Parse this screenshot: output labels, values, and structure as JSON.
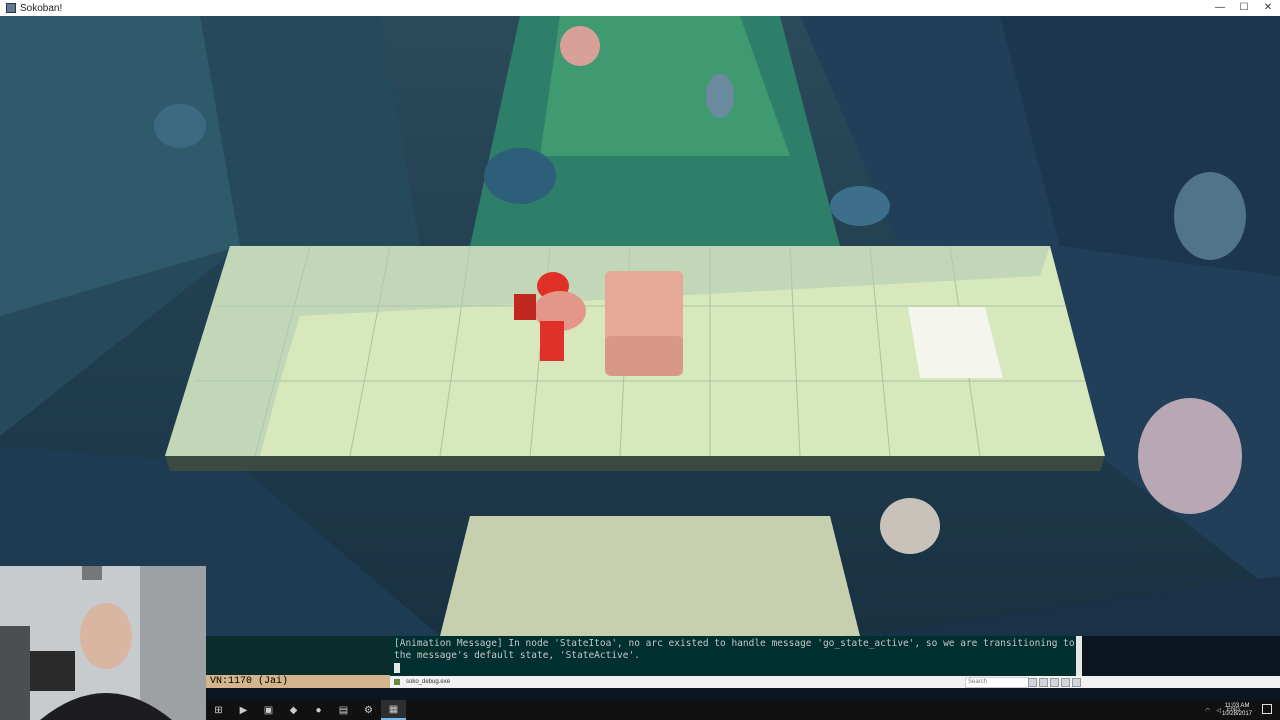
{
  "window": {
    "title": "Sokoban!",
    "minimize": "—",
    "maximize": "☐",
    "close": "✕"
  },
  "game": {
    "scene": "sokoban-level",
    "colors": {
      "floor": "#e5f0c4",
      "floor_shadow": "#b9d1b0",
      "crate": "#e6a898",
      "player": "#e03028",
      "goal": "#f4f6ee",
      "wall": "#27475a",
      "garden": "#2f8a6a"
    }
  },
  "editor": {
    "modeline": "VN:1170  (Jai)",
    "console_line1": "[Animation Message] In node 'StateItoa', no arc existed to handle message 'go_state_active', so we are transitioning to",
    "console_line2": "the message's default state, 'StateActive'."
  },
  "statusbar": {
    "exe_name": "soko_debug.exe",
    "search_placeholder": "Search"
  },
  "taskbar": {
    "icons": [
      "start-icon",
      "powershell-icon",
      "android-icon",
      "visual-studio-icon",
      "emacs-icon",
      "file-manager-icon",
      "settings-icon",
      "sokoban-app-icon"
    ],
    "tray": {
      "lang": "ENG",
      "time": "11:03 AM",
      "date": "10/28/2017"
    }
  }
}
